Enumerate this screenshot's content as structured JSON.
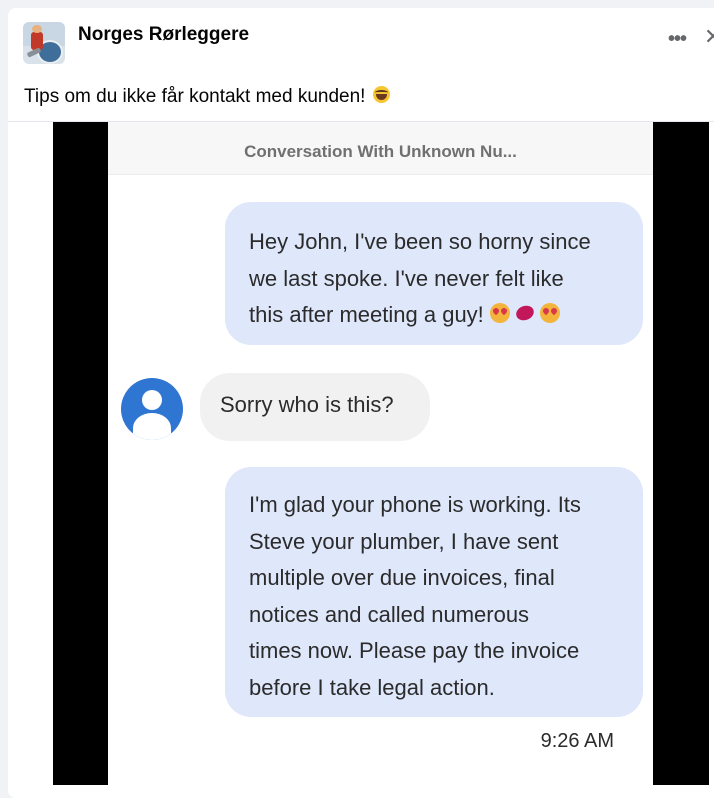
{
  "post": {
    "page_name": "Norges Rørleggere",
    "caption": "Tips om du ikke får kontakt med kunden!",
    "caption_emoji": "laughing-emoji",
    "more_icon": "more-options-icon",
    "close_icon": "close-icon"
  },
  "conversation": {
    "title": "Conversation With Unknown Nu...",
    "messages": [
      {
        "direction": "outgoing",
        "lines": [
          "Hey John, I've been so horny since",
          "we last spoke. I've never felt like",
          "this after meeting a guy!"
        ],
        "emojis": [
          "heart-eyes-emoji",
          "kiss-mark-emoji",
          "heart-eyes-emoji"
        ]
      },
      {
        "direction": "incoming",
        "text": "Sorry who is this?"
      },
      {
        "direction": "outgoing",
        "lines": [
          "I'm glad your phone is working. Its",
          "Steve your plumber, I have sent",
          "multiple over due invoices, final",
          "notices and called numerous",
          "times now. Please pay the invoice",
          "before I take legal action."
        ]
      }
    ],
    "timestamp": "9:26 AM"
  },
  "colors": {
    "outgoing_bubble": "#dfe7fb",
    "incoming_bubble": "#f1f1f1",
    "contact_avatar": "#2f76d2"
  }
}
